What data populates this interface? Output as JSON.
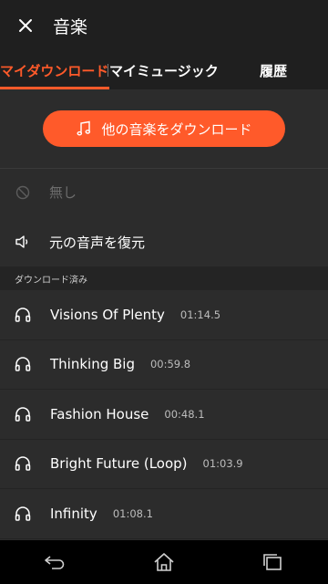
{
  "header": {
    "title": "音楽",
    "close_icon": "close-icon"
  },
  "tabs": [
    {
      "label": "マイダウンロード",
      "active": true
    },
    {
      "label": "マイミュージック",
      "active": false
    },
    {
      "label": "履歴",
      "active": false
    }
  ],
  "download_button": {
    "label": "他の音楽をダウンロード",
    "icon": "music-note-icon"
  },
  "none_option": {
    "label": "無し",
    "icon": "disabled-icon"
  },
  "restore_option": {
    "label": "元の音声を復元",
    "icon": "speaker-icon"
  },
  "section": {
    "title": "ダウンロード済み"
  },
  "tracks": [
    {
      "name": "Visions Of Plenty",
      "duration": "01:14.5"
    },
    {
      "name": "Thinking Big",
      "duration": "00:59.8"
    },
    {
      "name": "Fashion House",
      "duration": "00:48.1"
    },
    {
      "name": "Bright Future (Loop)",
      "duration": "01:03.9"
    },
    {
      "name": "Infinity",
      "duration": "01:08.1"
    }
  ],
  "colors": {
    "accent": "#ff5a2a",
    "background": "#2c2c2c",
    "header": "#1f1f1f"
  },
  "navbar": {
    "icons": [
      "back-icon",
      "home-icon",
      "recents-icon"
    ]
  }
}
